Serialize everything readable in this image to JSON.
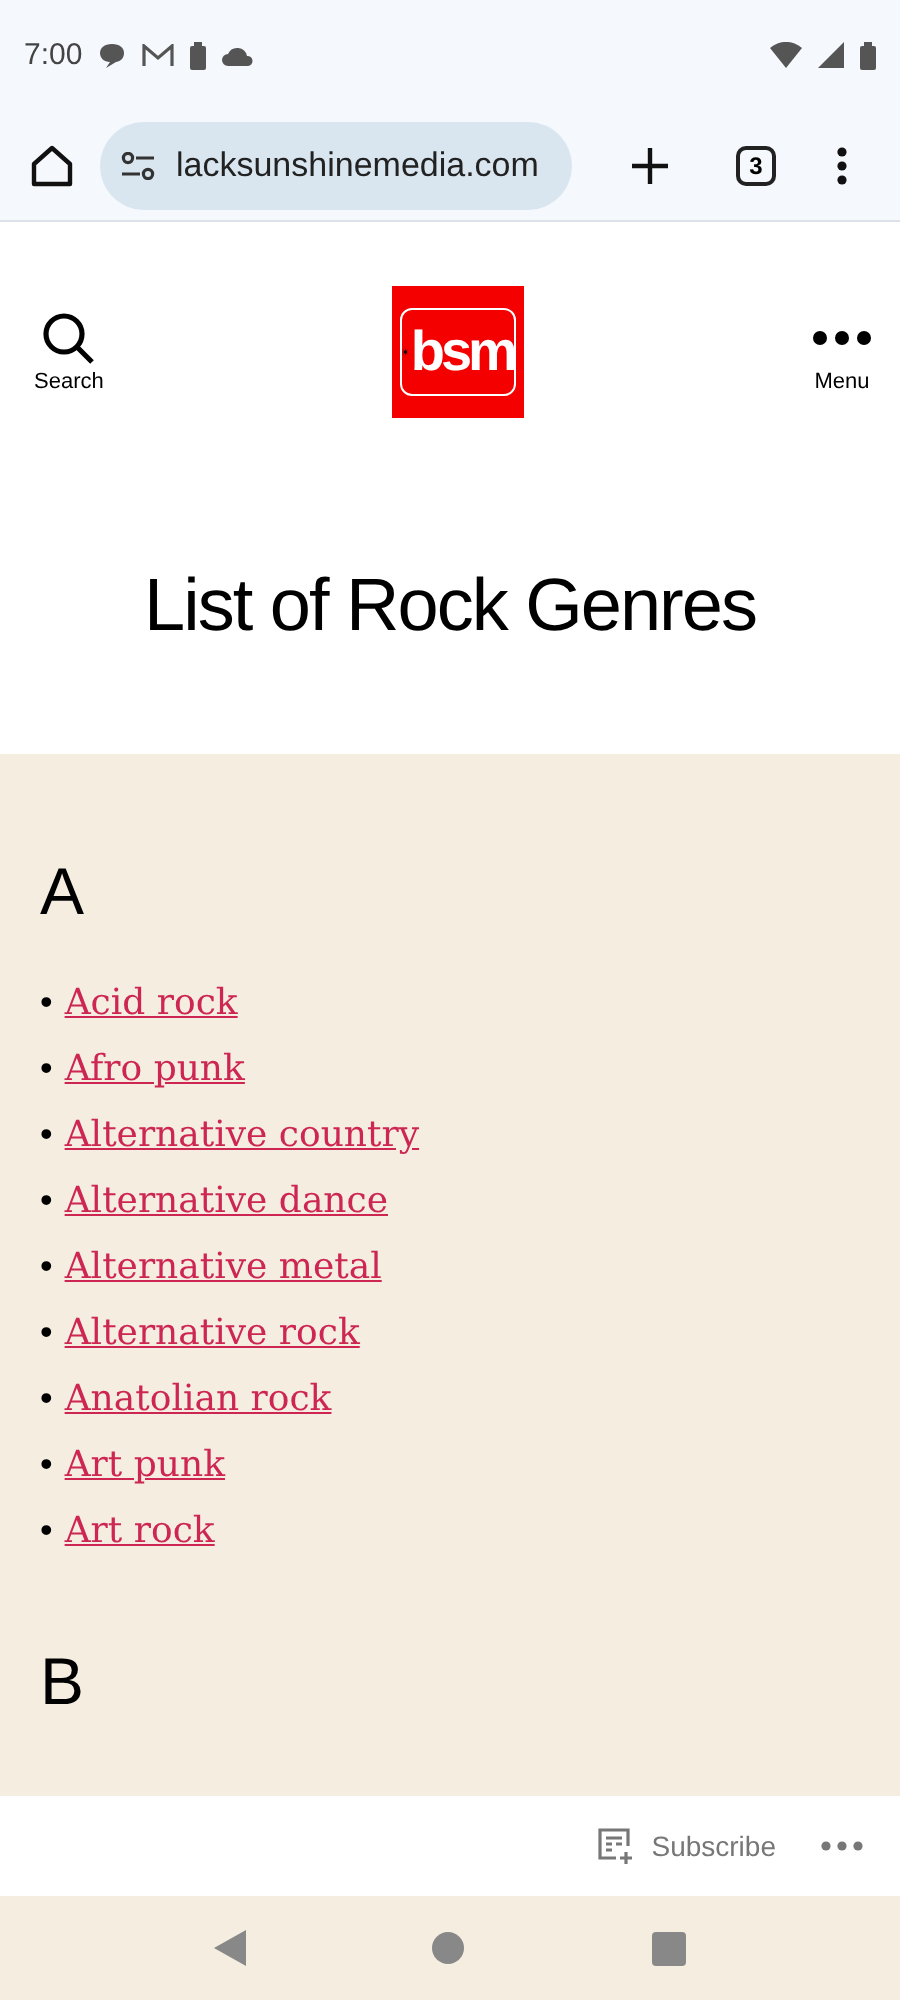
{
  "status_bar": {
    "time": "7:00"
  },
  "browser": {
    "url": "lacksunshinemedia.com",
    "tab_count": "3"
  },
  "header": {
    "search_label": "Search",
    "logo_text": "bsm",
    "menu_label": "Menu"
  },
  "title": "List of Rock Genres",
  "sections": [
    {
      "letter": "A",
      "bullet": "•",
      "items": [
        "Acid rock",
        "Afro punk",
        "Alternative country",
        "Alternative dance",
        "Alternative metal",
        "Alternative rock",
        "Anatolian rock",
        "Art punk",
        "Art rock"
      ]
    },
    {
      "letter": "B"
    }
  ],
  "subscribe_bar": {
    "label": "Subscribe"
  }
}
